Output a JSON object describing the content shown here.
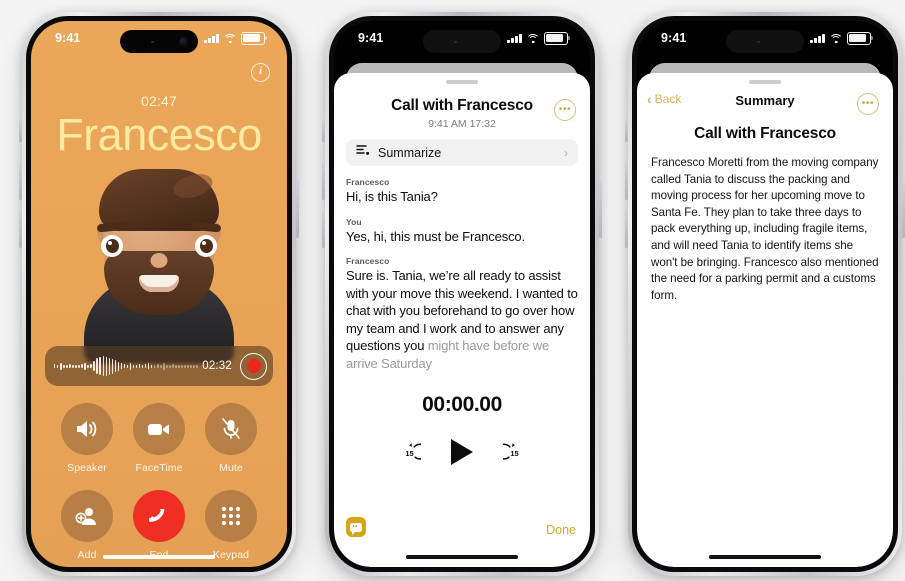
{
  "canvas": {
    "background": "#f4f4f4"
  },
  "phone1": {
    "name": "in-call-screen",
    "status_bar": {
      "time": "9:41",
      "icons": [
        "cellular-signal",
        "wifi",
        "battery"
      ]
    },
    "info_button": "i",
    "call_timer": "02:47",
    "caller_name": "Francesco",
    "accent_bg": "#eba75a",
    "name_color": "#fbeaa0",
    "recording_pill": {
      "elapsed": "02:32",
      "record_label": "record-stop"
    },
    "controls": [
      {
        "label": "Speaker",
        "icon": "speaker-icon"
      },
      {
        "label": "FaceTime",
        "icon": "video-camera-icon"
      },
      {
        "label": "Mute",
        "icon": "microphone-muted-icon"
      },
      {
        "label": "Add",
        "icon": "add-person-icon"
      },
      {
        "label": "End",
        "icon": "end-call-icon",
        "color": "#ef2f23"
      },
      {
        "label": "Keypad",
        "icon": "keypad-icon"
      }
    ]
  },
  "phone2": {
    "name": "call-recording-transcript-sheet",
    "status_bar": {
      "time": "9:41"
    },
    "title": "Call with Francesco",
    "subtitle": "9:41 AM  17:32",
    "more_button": "•••",
    "summarize": {
      "label": "Summarize",
      "icon": "summarize-list-icon",
      "chevron": "›"
    },
    "transcript": [
      {
        "speaker": "Francesco",
        "text": "Hi, is this Tania?",
        "faded": ""
      },
      {
        "speaker": "You",
        "text": "Yes, hi, this must be Francesco.",
        "faded": ""
      },
      {
        "speaker": "Francesco",
        "text": "Sure is. Tania, we’re all ready to assist with your move this weekend. I wanted to chat with you beforehand to go over how my team and I work and to answer any questions you ",
        "faded": "might have before we arrive Saturday"
      }
    ],
    "player": {
      "time": "00:00.00",
      "back_label": "15",
      "forward_label": "15",
      "play_icon": "play-icon"
    },
    "live_badge_icon": "live-transcription-icon",
    "done_label": "Done",
    "accent": "#d4a82c"
  },
  "phone3": {
    "name": "call-summary-screen",
    "status_bar": {
      "time": "9:41"
    },
    "back_label": "Back",
    "nav_title": "Summary",
    "more_button": "•••",
    "heading": "Call with Francesco",
    "body": "Francesco Moretti from the moving company called Tania to discuss the packing and moving process for her upcoming move to Santa Fe. They plan to take three days to pack everything up, including fragile items, and will need Tania to identify items she won't be bringing. Francesco also mentioned the need for a parking permit and a customs form.",
    "accent": "#d6b45c"
  }
}
